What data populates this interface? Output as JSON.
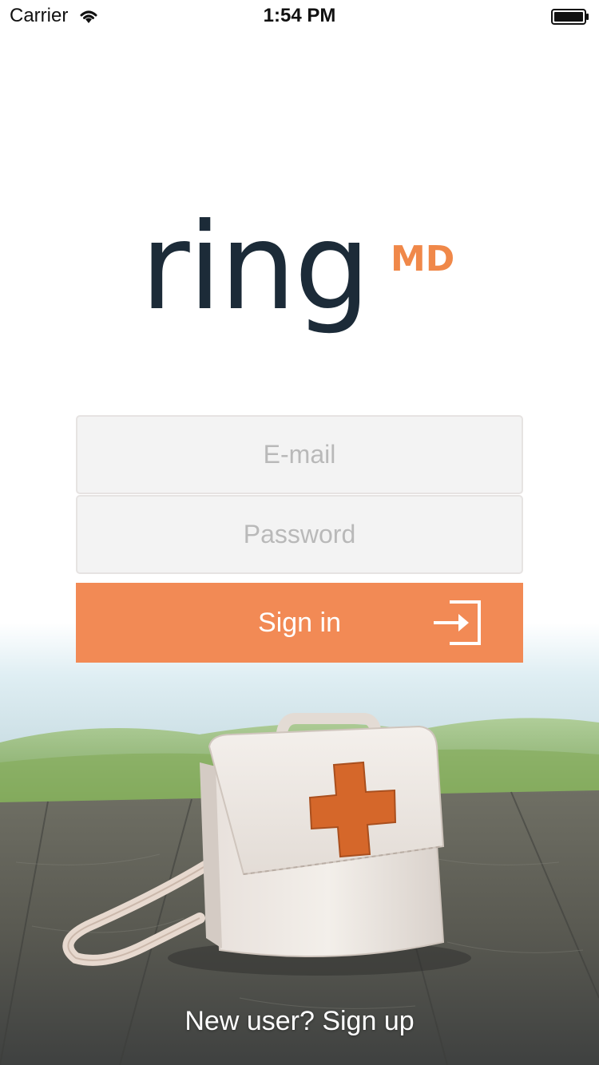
{
  "status_bar": {
    "carrier": "Carrier",
    "time": "1:54 PM"
  },
  "logo": {
    "word": "ring",
    "suffix": "MD"
  },
  "login": {
    "email_placeholder": "E-mail",
    "password_placeholder": "Password",
    "signin_label": "Sign in"
  },
  "signup": {
    "label": "New user? Sign up"
  },
  "icons": {
    "wifi": "wifi-icon",
    "battery": "battery-icon",
    "signin": "sign-in-icon"
  },
  "colors": {
    "accent": "#f28a55",
    "logo_dark": "#1c2b38",
    "logo_accent": "#f08849",
    "field_bg": "#f3f3f3",
    "placeholder": "#b9b9b9"
  }
}
